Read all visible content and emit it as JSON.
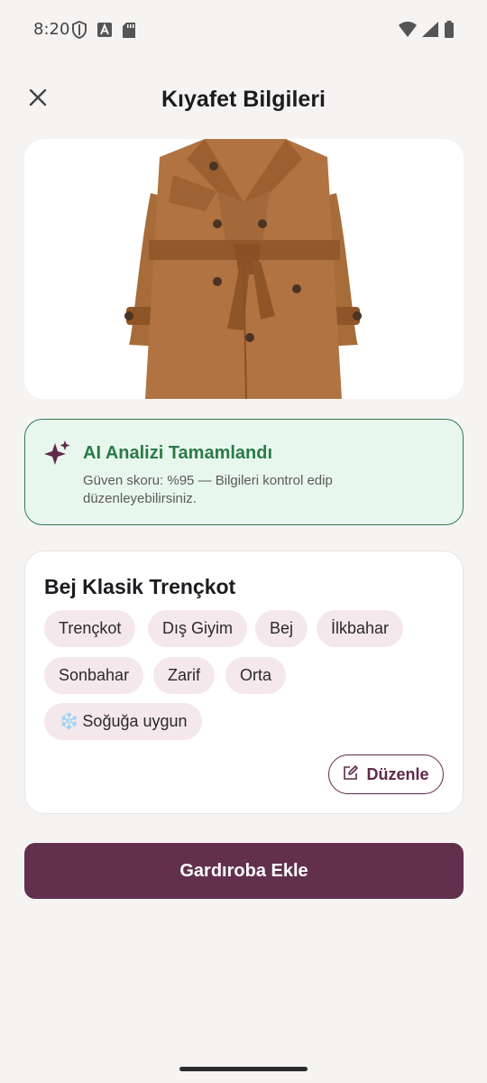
{
  "status_bar": {
    "time": "8:20",
    "icons_left": [
      "shield-icon",
      "font-a-icon",
      "sd-card-icon"
    ],
    "icons_right": [
      "wifi-icon",
      "signal-icon",
      "battery-icon"
    ]
  },
  "header": {
    "title": "Kıyafet Bilgileri",
    "close_icon": "close-icon"
  },
  "image": {
    "subject": "trench-coat-image"
  },
  "ai_card": {
    "icon": "sparkle-icon",
    "title": "AI Analizi Tamamlandı",
    "description": "Güven skoru: %95 — Bilgileri kontrol edip düzenleyebilirsiniz."
  },
  "item": {
    "title": "Bej Klasik Trençkot",
    "tags": [
      {
        "label": "Trençkot"
      },
      {
        "label": "Dış Giyim"
      },
      {
        "label": "Bej"
      },
      {
        "label": "İlkbahar"
      },
      {
        "label": "Sonbahar"
      },
      {
        "label": "Zarif"
      },
      {
        "label": "Orta"
      },
      {
        "label": "Soğuğa uygun",
        "icon": "❄️"
      }
    ],
    "edit_label": "Düzenle"
  },
  "primary_button": {
    "label": "Gardıroba Ekle"
  },
  "colors": {
    "background": "#F6F4F3",
    "accent": "#62304D",
    "success": "#2B7A47",
    "success_bg": "#E8F7EE",
    "tag_bg": "#F5E8EC"
  }
}
